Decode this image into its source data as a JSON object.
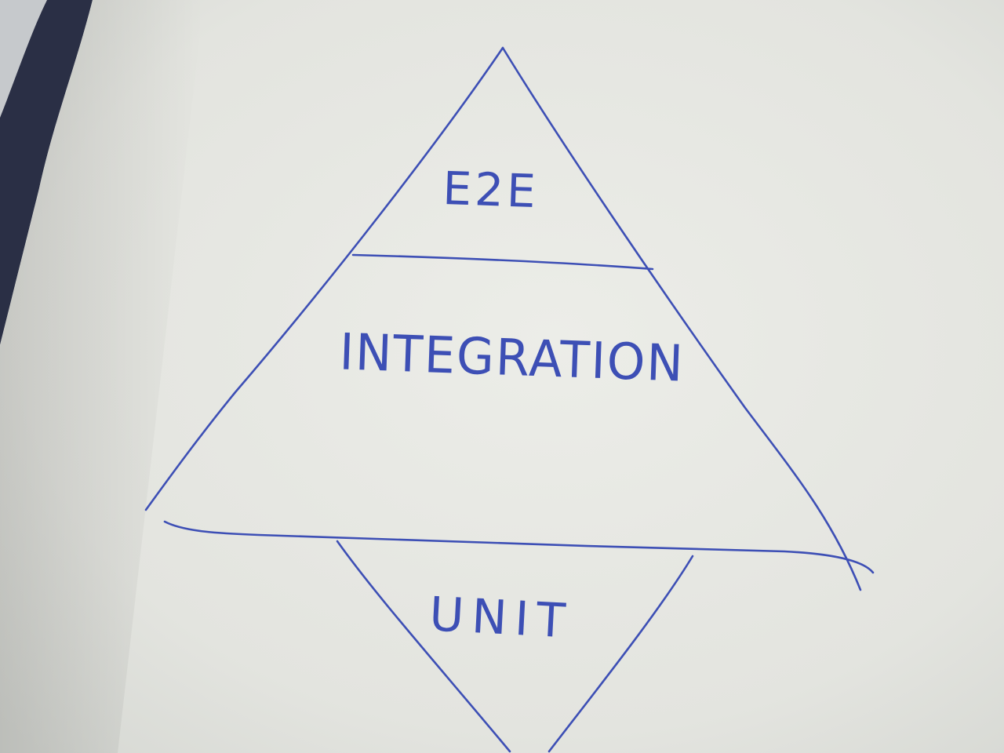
{
  "drawing": {
    "ink_color": "#3d4fb5",
    "paper_color": "#e7e8e3",
    "background_color": "#c9ccd0",
    "border_color": "#2a2f45",
    "top_section": {
      "label": "E2E"
    },
    "middle_section": {
      "label": "INTEGRATION"
    },
    "bottom_section": {
      "label": "UNIT"
    }
  }
}
